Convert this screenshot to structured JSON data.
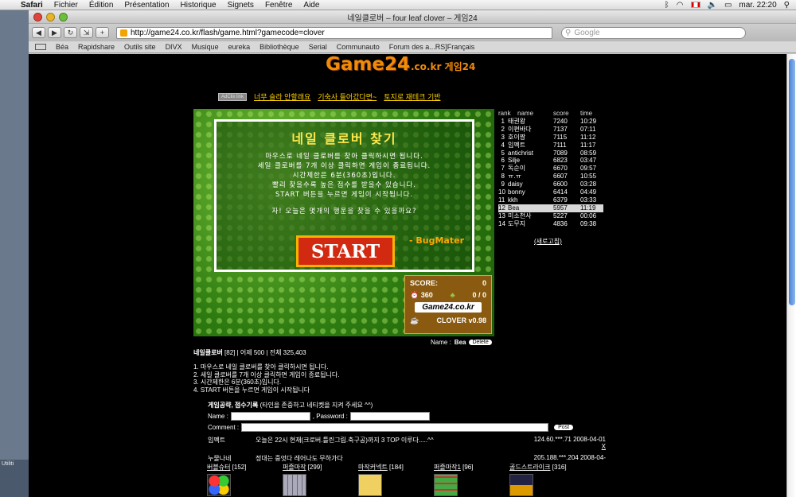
{
  "menubar": {
    "app": "Safari",
    "items": [
      "Fichier",
      "Édition",
      "Présentation",
      "Historique",
      "Signets",
      "Fenêtre",
      "Aide"
    ],
    "clock": "mar. 22:20"
  },
  "window": {
    "title": "네일클로버 – four leaf clover – 게임24",
    "url": "http://game24.co.kr/flash/game.html?gamecode=clover",
    "search_placeholder": "Google"
  },
  "bookmarks": [
    "Béa",
    "Rapidshare",
    "Outils site",
    "DIVX",
    "Musique",
    "eureka",
    "Bibliothèque",
    "Serial",
    "Communauto",
    "Forum des a...RS]Français"
  ],
  "site": {
    "logo": "Game24",
    "logo_suffix": ".co.kr 게임24",
    "nav_badge": "AdClix link",
    "nav_links": [
      "너무 슬라 안할래요",
      "기숙사 들어갔다면~",
      "토지로 재테크 기반"
    ]
  },
  "game": {
    "title": "네일 클로버 찾기",
    "lines": [
      "마우스로 네일 클로버를 찾아 클릭하시면 됩니다.",
      "세일 클로버를 7개 이상 클릭하면 게임이 종료됩니다.",
      "시간제한은 6분(360초)입니다.",
      "빨리 찾을수록 높은 점수를 받을수 있습니다.",
      "START 버튼을 누르면 게임이 시작됩니다."
    ],
    "question": "자! 오늘은 몇개의 행운을 찾을 수 있을까요?",
    "start_label": "START",
    "author": "- BugMater",
    "score_label": "SCORE:",
    "score": "0",
    "time": "360",
    "found": "0 / 0",
    "brand": "Game24.co.kr",
    "version": "CLOVER v0.98"
  },
  "ranking": {
    "headers": [
      "rank",
      "name",
      "score",
      "time"
    ],
    "rows": [
      {
        "rank": "1",
        "name": "태권왕",
        "score": "7240",
        "time": "10:29"
      },
      {
        "rank": "2",
        "name": "이편바다",
        "score": "7137",
        "time": "07:11"
      },
      {
        "rank": "3",
        "name": "호이짱",
        "score": "7115",
        "time": "11:12"
      },
      {
        "rank": "4",
        "name": "임펙트",
        "score": "7111",
        "time": "11:17"
      },
      {
        "rank": "5",
        "name": "antichrist",
        "score": "7089",
        "time": "08:59"
      },
      {
        "rank": "6",
        "name": "Silje",
        "score": "6823",
        "time": "03:47"
      },
      {
        "rank": "7",
        "name": "독순이",
        "score": "6670",
        "time": "09:57"
      },
      {
        "rank": "8",
        "name": "ㅠ.ㅠ",
        "score": "6607",
        "time": "10:55"
      },
      {
        "rank": "9",
        "name": "daisy",
        "score": "6600",
        "time": "03:28"
      },
      {
        "rank": "10",
        "name": "bonny",
        "score": "6414",
        "time": "04:49"
      },
      {
        "rank": "11",
        "name": "kkh",
        "score": "6379",
        "time": "03:33"
      },
      {
        "rank": "12",
        "name": "Bea",
        "score": "5957",
        "time": "11:19"
      },
      {
        "rank": "13",
        "name": "미소천사",
        "score": "5227",
        "time": "00:06"
      },
      {
        "rank": "14",
        "name": "도무지",
        "score": "4836",
        "time": "09:38"
      }
    ],
    "highlight_index": 11,
    "refresh": "(새로고침)"
  },
  "player": {
    "name_label": "Name :",
    "name": "Bea",
    "delete": "Delete"
  },
  "stats": {
    "game": "네일클로버",
    "text": "[82] | 어제 500 | 전체 325,403"
  },
  "rules": [
    "1. 마우스로 네일 클로버를 찾아 클릭하시면 됩니다.",
    "2. 세일 클로버를 7개 이상 클릭하면 게임이 종료됩니다.",
    "3. 시간제한은 6분(360초)입니다.",
    "4. START 버튼을 누르면 게임이 시작됩니다"
  ],
  "guestbook": {
    "title": "게임공략, 점수기록",
    "subtitle": "(타인을 존중하고 네티켓을 지켜 주세요 ^^)",
    "name_label": "Name :",
    "password_label": ", Password :",
    "comment_label": "Comment :",
    "post": "Post",
    "comments": [
      {
        "author": "임펙트",
        "text": "오늘은 22시 현재(크로버.틀린그림.축구공)까지 3 TOP 이루다.....^^",
        "ip": "124.60.***.71",
        "date": "2008-04-01",
        "x": "X"
      },
      {
        "author": "누물나네",
        "text": "정대는 중엇다 레어나도 무하가다",
        "ip": "205.188.***.204",
        "date": "2008-04-"
      }
    ]
  },
  "games": [
    {
      "label": "버블슈터",
      "count": "[152]"
    },
    {
      "label": "퍼즐마작",
      "count": "[299]"
    },
    {
      "label": "마작커넥트",
      "count": "[184]"
    },
    {
      "label": "퍼즐마작1",
      "count": "[96]"
    },
    {
      "label": "골드스트라이크",
      "count": "[316]"
    }
  ],
  "dock": {
    "label": "Utiliti"
  }
}
